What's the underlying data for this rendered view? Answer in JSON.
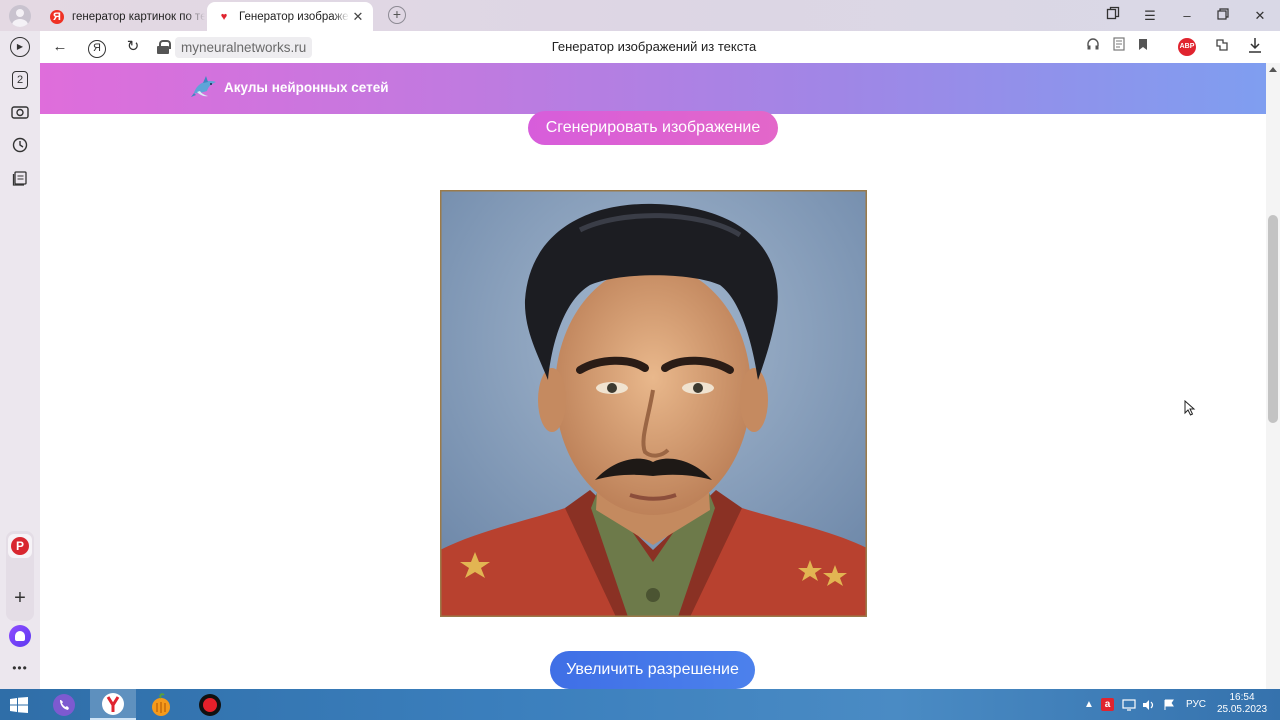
{
  "browser": {
    "tabs": [
      {
        "label": "генератор картинок по те",
        "icon": "yandex-favicon"
      },
      {
        "label": "Генератор изображени",
        "icon": "heart-favicon",
        "active": true
      }
    ],
    "address": "myneuralnetworks.ru",
    "page_title": "Генератор изображений из текста",
    "abp_label": "ABP",
    "nav_glyph": "Я"
  },
  "sidebar": {
    "badge_number": "2",
    "pinterest_label": "P"
  },
  "site": {
    "brand": "Акулы нейронных сетей",
    "generate_button": "Сгенерировать изображение",
    "upscale_button": "Увеличить разрешение"
  },
  "taskbar": {
    "language": "РУС",
    "time": "16:54",
    "date": "25.05.2023"
  },
  "colors": {
    "header_gradient_start": "#df6ddb",
    "header_gradient_end": "#7f9ef0",
    "generate_button": "#d75ddb",
    "upscale_button": "#3f6fe6",
    "taskbar": "#3b7fbd"
  }
}
